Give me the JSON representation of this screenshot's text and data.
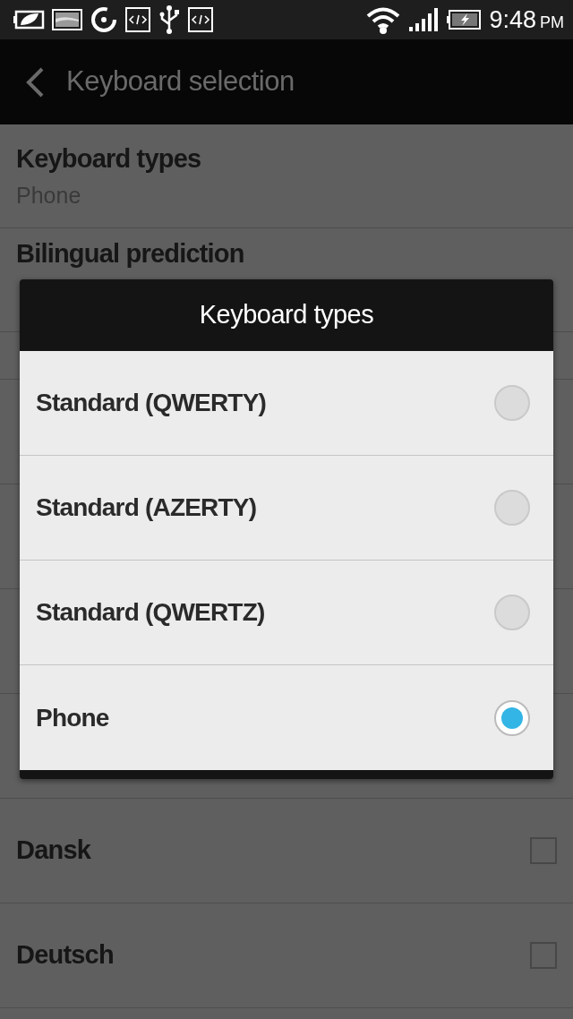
{
  "status_bar": {
    "time": "9:48",
    "ampm": "PM"
  },
  "app_bar": {
    "title": "Keyboard selection"
  },
  "settings": [
    {
      "kind": "detail",
      "title": "Keyboard types",
      "subtitle": "Phone"
    },
    {
      "kind": "heading",
      "title": "Bilingual prediction"
    },
    {
      "kind": "hidden"
    },
    {
      "kind": "hidden"
    },
    {
      "kind": "hidden"
    },
    {
      "kind": "hidden"
    },
    {
      "kind": "hidden"
    },
    {
      "kind": "checkbox",
      "title": "Dansk",
      "checked": false
    },
    {
      "kind": "checkbox",
      "title": "Deutsch",
      "checked": false
    }
  ],
  "dialog": {
    "title": "Keyboard types",
    "options": [
      {
        "label": "Standard (QWERTY)",
        "selected": false
      },
      {
        "label": "Standard (AZERTY)",
        "selected": false
      },
      {
        "label": "Standard (QWERTZ)",
        "selected": false
      },
      {
        "label": "Phone",
        "selected": true
      }
    ]
  }
}
